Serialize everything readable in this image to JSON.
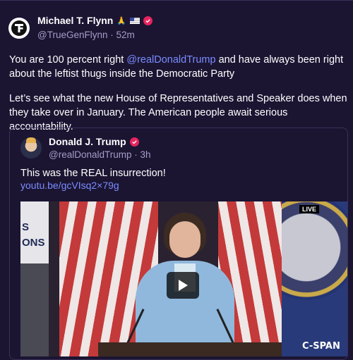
{
  "post": {
    "author_name": "Michael T. Flynn",
    "author_handle": "@TrueGenFlynn",
    "time": "52m",
    "name_emojis": "🙏",
    "paragraph1_mention": "@realDonaldTrump",
    "paragraph1_before": "You are 100 percent right ",
    "paragraph1_after": " and have always been right about the leftist thugs inside the Democratic Party",
    "paragraph2": "Let’s see what the new House of Representatives and Speaker does when they take over in January. The American people await serious accountability."
  },
  "quote": {
    "author_name": "Donald J. Trump",
    "author_handle": "@realDonaldTrump",
    "time": "3h",
    "text": "This was the REAL insurrection!",
    "link": "youtu.be/gcVIsq2×79g",
    "video": {
      "live_badge": "LIVE",
      "network": "C-SPAN",
      "left_sign_1": "S",
      "left_sign_2": "ONS"
    }
  },
  "colors": {
    "background": "#1b1532",
    "mention": "#7b8cff",
    "verified": "#e6245e",
    "muted": "#a59cc6"
  },
  "icons": [
    "truth-social-logo-icon",
    "verified-badge-icon",
    "us-flag-icon",
    "praying-hands-icon",
    "play-icon"
  ]
}
